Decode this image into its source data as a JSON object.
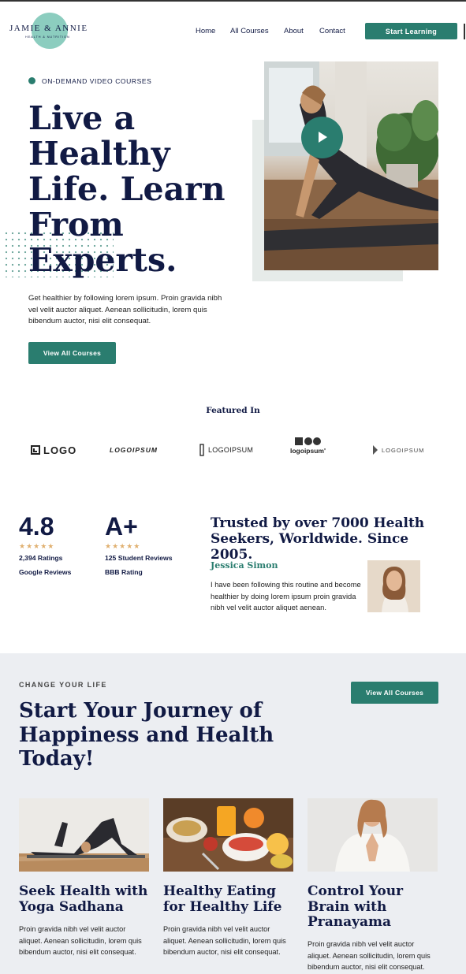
{
  "header": {
    "logo_name": "JAMIE & ANNIE",
    "logo_tagline": "HEALTH & NUTRITION",
    "nav": [
      "Home",
      "All Courses",
      "About",
      "Contact"
    ],
    "cta": "Start Learning"
  },
  "hero": {
    "eyebrow": "ON-DEMAND VIDEO COURSES",
    "title_lines": [
      "Live a",
      "Healthy",
      "Life. Learn",
      "From",
      "Experts."
    ],
    "body": "Get healthier by following lorem ipsum. Proin gravida nibh vel velit auctor aliquet. Aenean sollicitudin, lorem quis bibendum auctor, nisi elit consequat.",
    "button": "View All Courses"
  },
  "featured": {
    "title": "Featured In",
    "brands": [
      "LOGO",
      "LOGOIPSUM",
      "LOGOIPSUM",
      "logoipsum'",
      "LOGOIPSUM"
    ]
  },
  "stats": [
    {
      "value": "4.8",
      "stars": "★★★★★",
      "count": "2,394 Ratings",
      "source": "Google Reviews"
    },
    {
      "value": "A+",
      "stars": "★★★★★",
      "count": "125 Student Reviews",
      "source": "BBB Rating"
    }
  ],
  "testimonial": {
    "headline": "Trusted by over 7000 Health Seekers, Worldwide. Since 2005.",
    "name": "Jessica Simon",
    "quote": "I have been following this routine and become healthier by doing lorem ipsum proin gravida nibh vel velit auctor aliquet aenean."
  },
  "journey": {
    "kicker": "CHANGE YOUR LIFE",
    "title": "Start Your Journey of Happiness and Health Today!",
    "button": "View All Courses",
    "cards": [
      {
        "title": "Seek Health with Yoga Sadhana",
        "body": "Proin gravida nibh vel velit auctor aliquet. Aenean sollicitudin, lorem quis bibendum auctor, nisi elit consequat."
      },
      {
        "title": "Healthy Eating for Healthy Life",
        "body": "Proin gravida nibh vel velit auctor aliquet. Aenean sollicitudin, lorem quis bibendum auctor, nisi elit consequat."
      },
      {
        "title": "Control Your Brain with Pranayama",
        "body": "Proin gravida nibh vel velit auctor aliquet. Aenean sollicitudin, lorem quis bibendum auctor, nisi elit consequat."
      }
    ]
  },
  "colors": {
    "accent": "#2a7d6f",
    "navy": "#111a44",
    "mint": "#8ccdbf",
    "band": "#eceef2",
    "star": "#e0b070"
  },
  "icons": [
    "play-icon",
    "star-icon"
  ]
}
